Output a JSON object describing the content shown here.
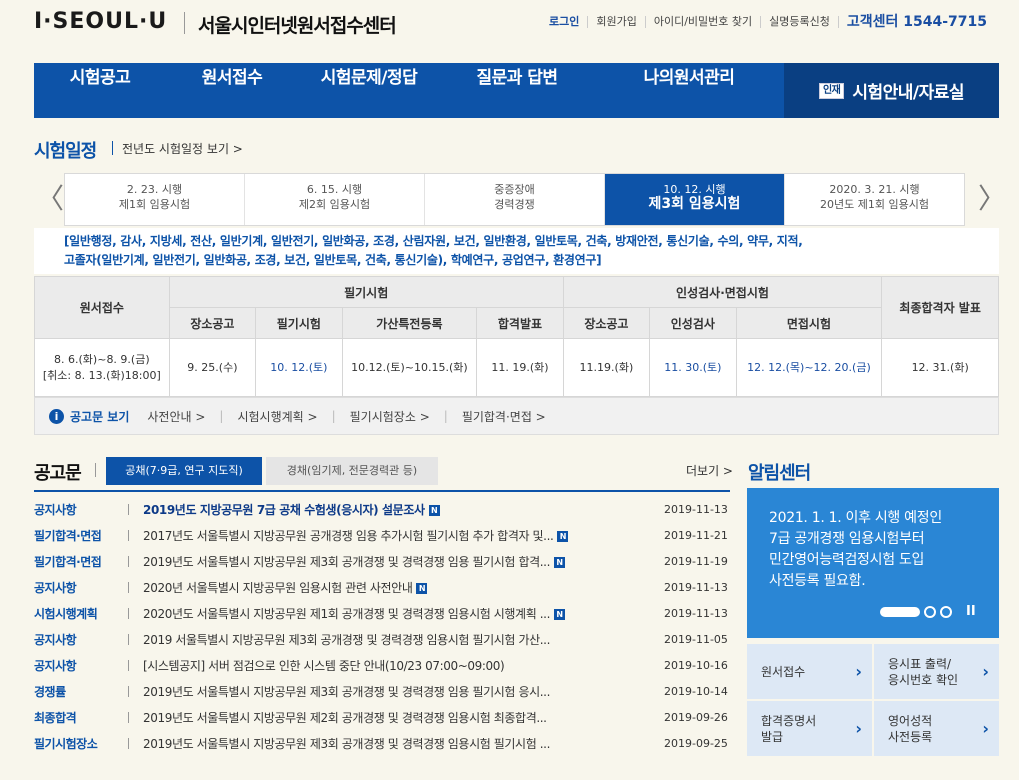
{
  "header": {
    "logo": "I·SEOUL·U",
    "site_title": "서울시인터넷원서접수센터",
    "util": [
      "로그인",
      "회원가입",
      "아이디/비밀번호 찾기",
      "실명등록신청"
    ],
    "contact": "고객센터 1544-7715"
  },
  "gnb": [
    "시험공고",
    "원서접수",
    "시험문제/정답",
    "질문과 답변",
    "나의원서관리",
    "시험안내/자료실"
  ],
  "gnb_badge": "인재",
  "schedule_section": {
    "title": "시험일정",
    "link": "전년도 시험일정 보기 >"
  },
  "exam_tabs": [
    {
      "l1": "2. 23. 시행",
      "l2": "제1회 임용시험",
      "active": false
    },
    {
      "l1": "6. 15. 시행",
      "l2": "제2회 임용시험",
      "active": false
    },
    {
      "l1": "중증장애",
      "l2": "경력경쟁",
      "active": false
    },
    {
      "l1": "10. 12. 시행",
      "l2": "제3회 임용시험",
      "active": true
    },
    {
      "l1": "2020. 3. 21. 시행",
      "l2": "20년도 제1회 임용시험",
      "active": false
    }
  ],
  "fields_line1": "[일반행정, 감사, 지방세, 전산, 일반기계, 일반전기, 일반화공, 조경, 산림자원, 보건, 일반환경, 일반토목, 건축, 방재안전, 통신기술, 수의, 약무, 지적,",
  "fields_line2": "고졸자(일반기계, 일반전기, 일반화공, 조경, 보건, 일반토목, 건축, 통신기술), 학예연구, 공업연구, 환경연구]",
  "table": {
    "h_apply": "원서접수",
    "h_written": "필기시험",
    "h_interview": "인성검사·면접시험",
    "h_final": "최종합격자 발표",
    "sub": [
      "장소공고",
      "필기시험",
      "가산특전등록",
      "합격발표",
      "장소공고",
      "인성검사",
      "면접시험"
    ],
    "apply1": "8. 6.(화)~8. 9.(금)",
    "apply2": "[취소: 8. 13.(화)18:00]",
    "cells": [
      "9. 25.(수)",
      "10. 12.(토)",
      "10.12.(토)~10.15.(화)",
      "11. 19.(화)",
      "11.19.(화)",
      "11. 30.(토)",
      "12. 12.(목)~12. 20.(금)"
    ],
    "final": "12. 31.(화)"
  },
  "guide": {
    "label": "공고문 보기",
    "items": [
      "사전안내 >",
      "시험시행계획 >",
      "필기시험장소 >",
      "필기합격·면접 >"
    ]
  },
  "notices": {
    "title": "공고문",
    "tab1": "공채(7·9급, 연구 지도직)",
    "tab2": "경채(임기제, 전문경력관 등)",
    "more": "더보기 >",
    "rows": [
      {
        "cat": "공지사항",
        "text": "2019년도 지방공무원 7급 공채 수험생(응시자) 설문조사",
        "date": "2019-11-13",
        "bold": true,
        "new": true
      },
      {
        "cat": "필기합격·면접",
        "text": "2017년도 서울특별시 지방공무원 공개경쟁 임용 추가시험 필기시험 추가 합격자 및...",
        "date": "2019-11-21",
        "bold": false,
        "new": true
      },
      {
        "cat": "필기합격·면접",
        "text": "2019년도 서울특별시 지방공무원 제3회 공개경쟁 및 경력경쟁 임용 필기시험 합격...",
        "date": "2019-11-19",
        "bold": false,
        "new": true
      },
      {
        "cat": "공지사항",
        "text": "2020년 서울특별시 지방공무원 임용시험 관련 사전안내",
        "date": "2019-11-13",
        "bold": false,
        "new": true
      },
      {
        "cat": "시험시행계획",
        "text": "2020년도 서울특별시 지방공무원 제1회 공개경쟁 및 경력경쟁 임용시험 시행계획 ...",
        "date": "2019-11-13",
        "bold": false,
        "new": true
      },
      {
        "cat": "공지사항",
        "text": "2019 서울특별시 지방공무원 제3회 공개경쟁 및 경력경쟁 임용시험 필기시험 가산...",
        "date": "2019-11-05",
        "bold": false,
        "new": false
      },
      {
        "cat": "공지사항",
        "text": "[시스템공지] 서버 점검으로 인한 시스템 중단 안내(10/23 07:00~09:00)",
        "date": "2019-10-16",
        "bold": false,
        "new": false
      },
      {
        "cat": "경쟁률",
        "text": "2019년도 서울특별시 지방공무원 제3회 공개경쟁 및 경력경쟁 임용 필기시험 응시...",
        "date": "2019-10-14",
        "bold": false,
        "new": false
      },
      {
        "cat": "최종합격",
        "text": "2019년도 서울특별시 지방공무원 제2회 공개경쟁 및 경력경쟁 임용시험 최종합격...",
        "date": "2019-09-26",
        "bold": false,
        "new": false
      },
      {
        "cat": "필기시험장소",
        "text": "2019년도 서울특별시 지방공무원 제3회 공개경쟁 및 경력경쟁 임용시험 필기시험 ...",
        "date": "2019-09-25",
        "bold": false,
        "new": false
      }
    ]
  },
  "alert": {
    "title": "알림센터",
    "lines": [
      "2021. 1. 1. 이후 시행 예정인",
      "7급 공개경쟁 임용시험부터",
      "민간영어능력검정시험 도입",
      "사전등록 필요함."
    ],
    "pause": "II"
  },
  "quick": [
    {
      "l1": "원서접수",
      "l2": ""
    },
    {
      "l1": "응시표 출력/",
      "l2": "응시번호 확인"
    },
    {
      "l1": "합격증명서",
      "l2": "발급"
    },
    {
      "l1": "영어성적",
      "l2": "사전등록"
    }
  ],
  "new_badge": "N",
  "arrows": {
    "prev": "〈",
    "next": "〉",
    "chev": "›"
  },
  "colors": {
    "primary": "#0d53a8",
    "accent": "#2a86d5",
    "background": "#f8f6ec"
  }
}
